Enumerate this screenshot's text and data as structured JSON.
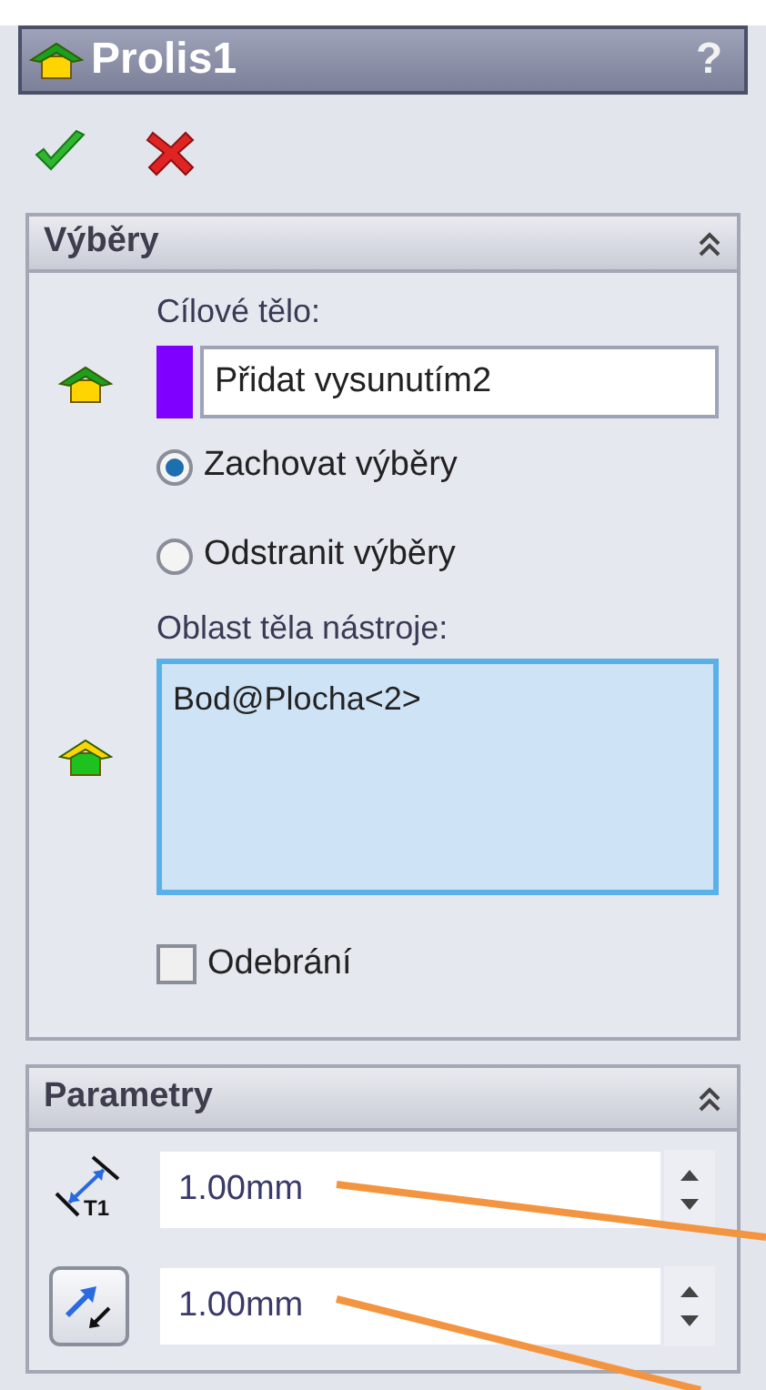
{
  "window": {
    "title": "Prolis1",
    "help": "?"
  },
  "selections": {
    "title": "Výběry",
    "target_label": "Cílové tělo:",
    "target_value": "Přidat vysunutím2",
    "options": [
      {
        "label": "Zachovat výběry",
        "selected": true
      },
      {
        "label": "Odstranit výběry",
        "selected": false
      }
    ],
    "tool_label": "Oblast těla nástroje:",
    "tool_items": [
      "Bod@Plocha<2>"
    ],
    "remove": {
      "label": "Odebrání",
      "checked": false
    }
  },
  "parameters": {
    "title": "Parametry",
    "icon_text": "T1",
    "fields": [
      {
        "kind": "thickness",
        "value": "1.00mm"
      },
      {
        "kind": "direction",
        "value": "1.00mm"
      }
    ]
  }
}
